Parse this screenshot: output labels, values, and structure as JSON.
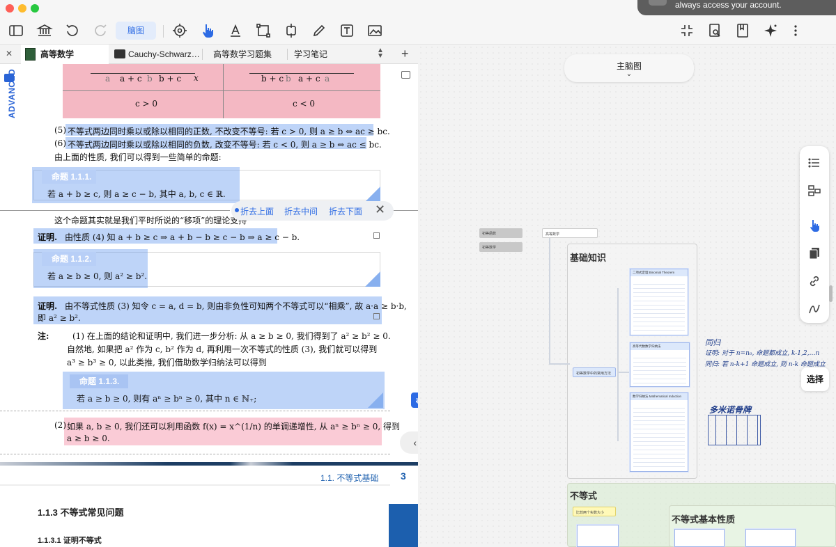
{
  "notification": {
    "text": "always access your account."
  },
  "toolbar": {
    "mode_label": "脑图"
  },
  "tabs": [
    {
      "label": "高等数学",
      "active": true
    },
    {
      "label": "Cauchy-Schwarz…",
      "active": false
    },
    {
      "label": "高等数学习题集",
      "active": false
    },
    {
      "label": "学习笔记",
      "active": false
    }
  ],
  "doc": {
    "advanced_label": "ADVANCED",
    "number_line_left": {
      "labels": [
        "a",
        "a + c",
        "b",
        "b + c"
      ],
      "axis_var": "x",
      "condition": "c > 0"
    },
    "number_line_right": {
      "labels": [
        "b + c",
        "b",
        "a + c",
        "a"
      ],
      "condition": "c < 0"
    },
    "item5_num": "(5)",
    "item5_text": "不等式两边同时乘以或除以相同的正数, 不改变不等号: 若 c > 0, 则 a ≥ b ⇔ ac ≥ bc.",
    "item6_num": "(6)",
    "item6_text": "不等式两边同时乘以或除以相同的负数, 改变不等号: 若 c < 0, 则 a ≥ b ⇔ ac ≤ bc.",
    "intro_line": "由上面的性质, 我们可以得到一些简单的命题:",
    "prop1_title": "命题 1.1.1.",
    "prop1_body": "若 a + b ≥ c, 则 a ≥ c − b, 其中 a, b, c ∈ ℝ.",
    "after_prop1": "这个命题其实就是我们平时所说的“移项”的理论支持",
    "proof1_label": "证明.",
    "proof1_body": "由性质 (4) 知 a + b ≥ c ⇒ a + b − b ≥ c − b ⇒ a ≥ c − b.",
    "prop2_title": "命题 1.1.2.",
    "prop2_body": "若 a ≥ b ≥ 0, 则 a² ≥ b².",
    "proof2_label": "证明.",
    "proof2_line1": "由不等式性质 (3) 知令 c = a, d = b, 则由非负性可知两个不等式可以“相乘”, 故 a·a ≥ b·b,",
    "proof2_line2": "即 a² ≥ b².",
    "note_label": "注:",
    "note_line1": "(1) 在上面的结论和证明中, 我们进一步分析: 从 a ≥ b ≥ 0, 我们得到了 a² ≥ b² ≥ 0.",
    "note_line2": "自然地, 如果把 a² 作为 c, b² 作为 d, 再利用一次不等式的性质 (3), 我们就可以得到",
    "note_line3": "a³ ≥ b³ ≥ 0, 以此类推, 我们借助数学归纳法可以得到",
    "prop3_title": "命题 1.1.3.",
    "prop3_body": "若 a ≥ b ≥ 0, 则有 aⁿ ≥ bⁿ ≥ 0, 其中 n ∈ ℕ₊;",
    "note2_num": "(2)",
    "note2_line1": "如果 a, b ≥ 0, 我们还可以利用函数 f(x) = x^(1/n) 的单调递增性, 从 aⁿ ≥ bⁿ ≥ 0, 得到",
    "note2_line2": "a ≥ b ≥ 0.",
    "footer_section": "1.1.  不等式基础",
    "footer_page": "3",
    "section_title": "1.1.3  不等式常见问题",
    "subsection_title": "1.1.3.1  证明不等式"
  },
  "fold_menu": {
    "up": "折去上面",
    "middle": "折去中间",
    "down": "折去下面"
  },
  "mindmap": {
    "main_button": "主脑图",
    "select_button": "选择",
    "small_nodes": [
      "初等函数",
      "初等数学",
      "高等数学"
    ],
    "group1_title": "基础知识",
    "group1_branch": "初等数学中的常用方法",
    "card1_title": "二项式定理 Binomial Theorem",
    "card2_title": "高等代数数学归纳法",
    "card3_title": "数学归纳法 Mathematical Induction",
    "group2_title": "不等式",
    "group2_node": "比较两个实数大小",
    "group3_title": "不等式基本性质",
    "ink_induction": "同归",
    "ink_proof": "证明: 对于 n=n₀, 命题都成立, k-1,2,…n",
    "ink_recursion": "同归: 若 n-k+1 命题成立, 则 n-k 命题成立",
    "ink_domino": "多米诺骨牌"
  },
  "colors": {
    "accent": "#2d6be4",
    "highlight_blue": "#6ea0f0",
    "highlight_pink": "#f5a0b4",
    "box_pink": "#f4b8c3"
  }
}
